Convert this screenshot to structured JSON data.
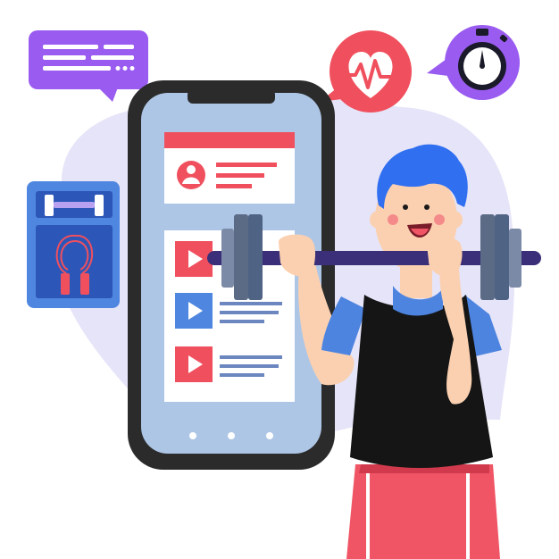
{
  "colors": {
    "background": "#ffffff",
    "blob": "#e6e4f8",
    "phone_frame": "#2b2b2b",
    "phone_screen": "#aec6e6",
    "card": "#ffffff",
    "accent_red": "#f0505e",
    "accent_blue": "#4f86e0",
    "purple": "#9a5cf0",
    "hair": "#2f6ff0",
    "skin": "#fbd0b0",
    "shirt": "#151515",
    "sleeve": "#4d84e0",
    "shorts": "#f05565",
    "bar": "#3a2f78",
    "plate": "#5b6b86"
  },
  "icons": {
    "chat_bubble": "message-lines-icon",
    "heart_bubble": "heart-pulse-icon",
    "stopwatch_bubble": "stopwatch-icon",
    "equipment_panel": "dumbbell-and-jump-rope-icon",
    "profile": "user-avatar-icon",
    "play": "play-icon"
  },
  "phone": {
    "video_items": 3,
    "page_dots": 3
  }
}
